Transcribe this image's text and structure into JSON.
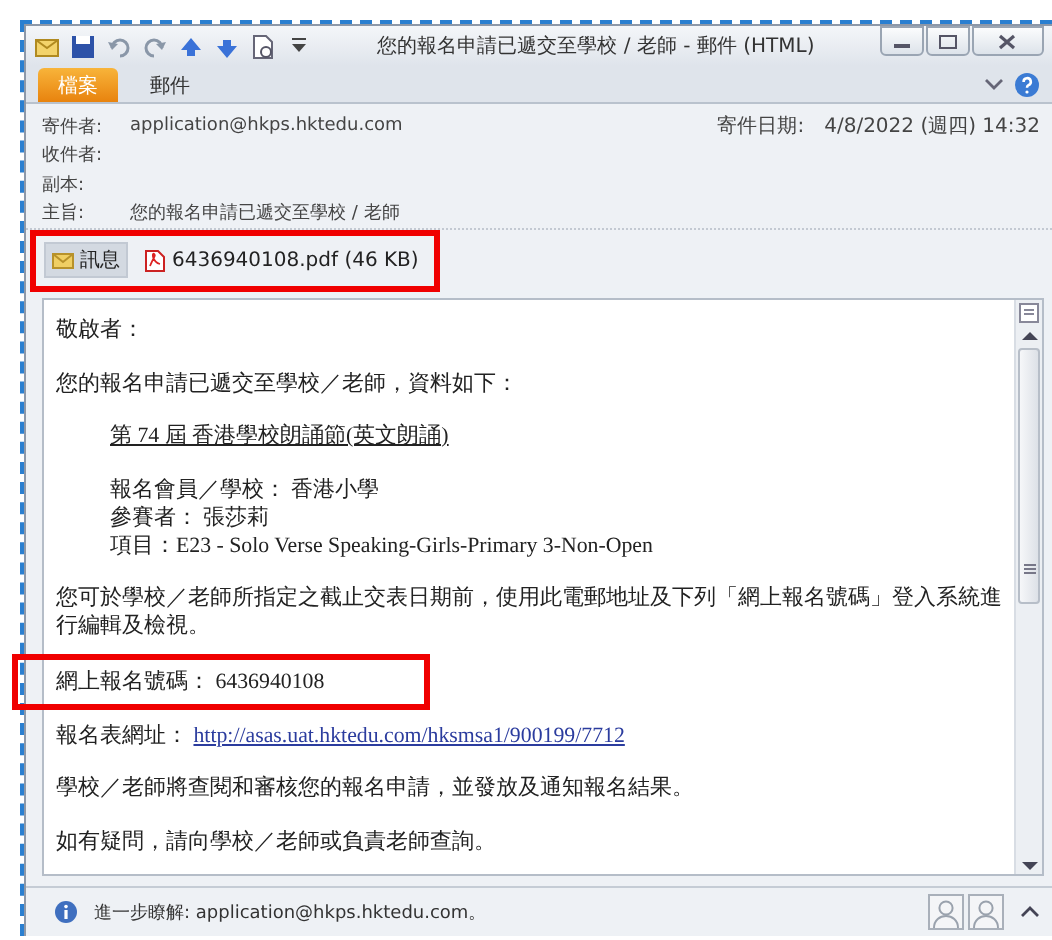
{
  "window": {
    "title": "您的報名申請已遞交至學校 / 老師 - 郵件 (HTML)"
  },
  "ribbon_tabs": [
    {
      "label": "檔案",
      "kind": "file"
    },
    {
      "label": "郵件",
      "kind": "tab"
    }
  ],
  "header": {
    "fields": [
      {
        "label": "寄件者:",
        "value": "application@hkps.hktedu.com"
      },
      {
        "label": "收件者:"
      },
      {
        "label": "副本:"
      },
      {
        "label": "主旨:",
        "value": "您的報名申請已遞交至學校 / 老師"
      }
    ],
    "sent": {
      "label": "寄件日期:",
      "value": "4/8/2022 (週四) 14:32"
    }
  },
  "attachments": {
    "highlighted": true,
    "items": [
      {
        "label": "訊息",
        "kind": "message",
        "selected": true
      },
      {
        "label": "6436940108.pdf (46 KB)",
        "kind": "pdf",
        "selected": false
      }
    ]
  },
  "body": [
    {
      "kind": "text",
      "text": "敬啟者：",
      "highlighted": false
    },
    {
      "kind": "text",
      "text": "您的報名申請已遞交至學校／老師，資料如下：",
      "highlighted": false
    },
    {
      "kind": "title",
      "text": "第 74 屆 香港學校朗誦節(英文朗誦)",
      "highlighted": false
    },
    {
      "kind": "detail",
      "text": "報名會員／學校： 香港小學",
      "highlighted": false
    },
    {
      "kind": "detail",
      "text": "參賽者： 張莎莉",
      "highlighted": false
    },
    {
      "kind": "detail",
      "text": "項目：E23 - Solo Verse Speaking-Girls-Primary 3-Non-Open",
      "highlighted": false
    },
    {
      "kind": "text",
      "text": "您可於學校／老師所指定之截止交表日期前，使用此電郵地址及下列「網上報名號碼」登入系統進行編輯及檢視。",
      "highlighted": false
    },
    {
      "kind": "text",
      "text": "網上報名號碼： 6436940108",
      "highlighted": true
    },
    {
      "kind": "link",
      "label": "報名表網址：",
      "url": "http://asas.uat.hktedu.com/hksmsa1/900199/7712",
      "highlighted": false
    },
    {
      "kind": "text",
      "text": "學校／老師將查閱和審核您的報名申請，並發放及通知報名結果。",
      "highlighted": false
    },
    {
      "kind": "text",
      "text": "如有疑問，請向學校／老師或負責老師查詢。",
      "highlighted": false
    }
  ],
  "status_bar": {
    "text": "進一步瞭解: application@hkps.hktedu.com。"
  }
}
